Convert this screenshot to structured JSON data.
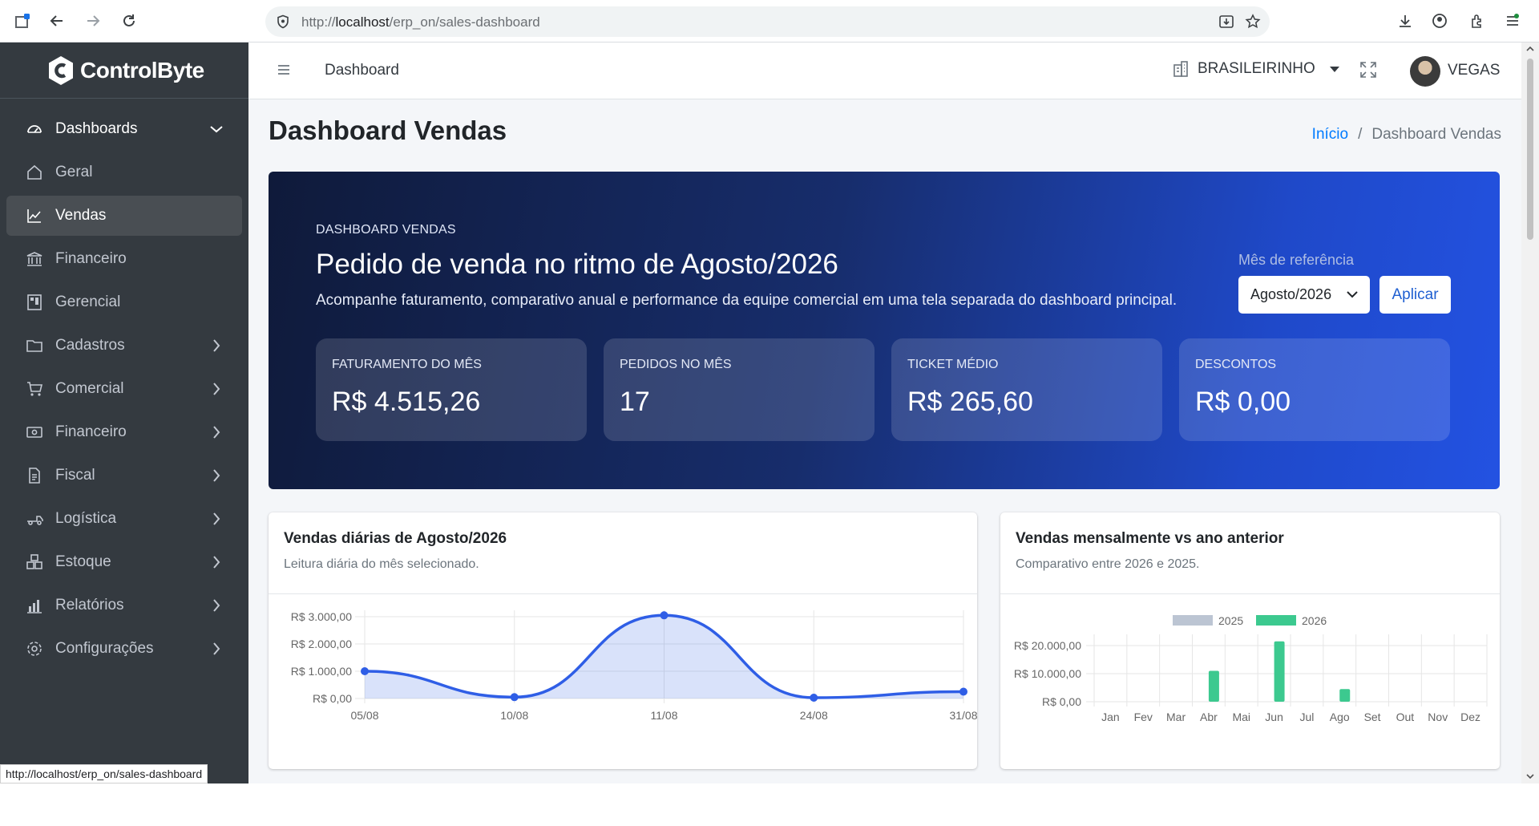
{
  "browser": {
    "url_prefix": "http://",
    "url_host": "localhost",
    "url_path": "/erp_on/sales-dashboard",
    "status_url": "http://localhost/erp_on/sales-dashboard"
  },
  "sidebar": {
    "brand": "ControlByte",
    "items": [
      {
        "label": "Dashboards",
        "icon": "gauge-icon",
        "chevron": "down"
      },
      {
        "label": "Geral",
        "icon": "home-icon"
      },
      {
        "label": "Vendas",
        "icon": "chart-line-icon",
        "active": true
      },
      {
        "label": "Financeiro",
        "icon": "bank-icon"
      },
      {
        "label": "Gerencial",
        "icon": "building-icon"
      },
      {
        "label": "Cadastros",
        "icon": "folder-icon",
        "chevron": "right"
      },
      {
        "label": "Comercial",
        "icon": "cart-icon",
        "chevron": "right"
      },
      {
        "label": "Financeiro",
        "icon": "money-icon",
        "chevron": "right"
      },
      {
        "label": "Fiscal",
        "icon": "file-icon",
        "chevron": "right"
      },
      {
        "label": "Logística",
        "icon": "truck-icon",
        "chevron": "right"
      },
      {
        "label": "Estoque",
        "icon": "boxes-icon",
        "chevron": "right"
      },
      {
        "label": "Relatórios",
        "icon": "bar-chart-icon",
        "chevron": "right"
      },
      {
        "label": "Configurações",
        "icon": "gear-icon",
        "chevron": "right"
      }
    ]
  },
  "header": {
    "title": "Dashboard",
    "company": "BRASILEIRINHO",
    "user": "VEGAS"
  },
  "page": {
    "title": "Dashboard Vendas",
    "breadcrumb_home": "Início",
    "breadcrumb_sep": "/",
    "breadcrumb_current": "Dashboard Vendas"
  },
  "hero": {
    "kicker": "DASHBOARD VENDAS",
    "title": "Pedido de venda no ritmo de Agosto/2026",
    "subtitle": "Acompanhe faturamento, comparativo anual e performance da equipe comercial em uma tela separada do dashboard principal.",
    "ref_label": "Mês de referência",
    "ref_value": "Agosto/2026",
    "apply_label": "Aplicar",
    "kpis": [
      {
        "label": "FATURAMENTO DO MÊS",
        "value": "R$ 4.515,26"
      },
      {
        "label": "PEDIDOS NO MÊS",
        "value": "17"
      },
      {
        "label": "TICKET MÉDIO",
        "value": "R$ 265,60"
      },
      {
        "label": "DESCONTOS",
        "value": "R$ 0,00"
      }
    ]
  },
  "daily_card": {
    "title": "Vendas diárias de Agosto/2026",
    "subtitle": "Leitura diária do mês selecionado."
  },
  "monthly_card": {
    "title": "Vendas mensalmente vs ano anterior",
    "subtitle": "Comparativo entre 2026 e 2025."
  },
  "chart_data": [
    {
      "type": "line",
      "x": [
        "05/08",
        "10/08",
        "11/08",
        "24/08",
        "31/08"
      ],
      "values": [
        1000,
        50,
        3050,
        30,
        250
      ],
      "ylim": [
        0,
        3000
      ],
      "y_ticks": [
        "R$ 0,00",
        "R$ 1.000,00",
        "R$ 2.000,00",
        "R$ 3.000,00"
      ],
      "y_tick_values": [
        0,
        1000,
        2000,
        3000
      ],
      "fill": true,
      "color": "#2f5ee6",
      "grid": true
    },
    {
      "type": "bar",
      "categories": [
        "Jan",
        "Fev",
        "Mar",
        "Abr",
        "Mai",
        "Jun",
        "Jul",
        "Ago",
        "Set",
        "Out",
        "Nov",
        "Dez"
      ],
      "series": [
        {
          "name": "2025",
          "color": "#bcc5d3",
          "values": [
            0,
            0,
            0,
            0,
            0,
            0,
            0,
            0,
            0,
            0,
            0,
            0
          ]
        },
        {
          "name": "2026",
          "color": "#3cc98f",
          "values": [
            0,
            0,
            0,
            11000,
            0,
            21500,
            0,
            4500,
            0,
            0,
            0,
            0
          ]
        }
      ],
      "ylim": [
        0,
        24000
      ],
      "y_ticks": [
        "R$ 0,00",
        "R$ 10.000,00",
        "R$ 20.000,00"
      ],
      "y_tick_values": [
        0,
        10000,
        20000
      ],
      "legend": "top",
      "grid": true
    }
  ]
}
